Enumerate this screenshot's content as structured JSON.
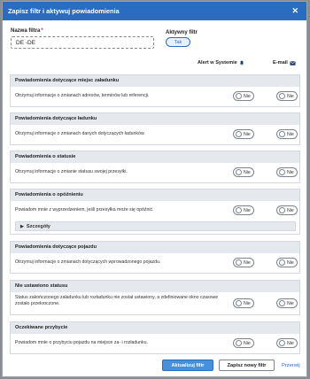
{
  "modal": {
    "title": "Zapisz filtr i aktywuj powiadomienia",
    "close_icon": "close-icon"
  },
  "form": {
    "name_label": "Nazwa filtra",
    "required_mark": "*",
    "name_value": "DE -DE",
    "active_label": "Aktywny filtr",
    "active_toggle": "Tak"
  },
  "columns": {
    "alert": "Alert w Systemie",
    "alert_icon": "bell-icon",
    "email": "E-mail",
    "email_icon": "envelope-icon"
  },
  "toggle_off_label": "Nie",
  "sections": [
    {
      "title": "Powiadomienia dotyczące miejsc załadunku",
      "description": "Otrzymuj informacje o zmianach adresów, terminów lub referencji."
    },
    {
      "title": "Powiadomienia dotyczące ładunku",
      "description": "Otrzymuj informacje o zmianach danych dotyczących ładunków."
    },
    {
      "title": "Powiadomienia o statusie",
      "description": "Otrzymuj informacje o zmianie statusu swojej przesyłki."
    },
    {
      "title": "Powiadomienia o opóźnieniu",
      "description": "Powiadom mnie z wyprzedzeniem, jeśli przesyłka może się opóźnić.",
      "details_label": "Szczegóły"
    },
    {
      "title": "Powiadomienia dotyczące pojazdu",
      "description": "Otrzymuj informacje o zmianach dotyczących wprowadzonego pojazdu."
    },
    {
      "title": "Nie ustawiono statusu",
      "description": "Status zakończonego załadunku lub rozładunku nie został ustawiony, a zdefiniowane okno czasowe zostało przekroczone."
    },
    {
      "title": "Oczekiwane przybycie",
      "description": "Powiadom mnie o przybyciu pojazdu na miejsce za- i rozładunku."
    }
  ],
  "footer": {
    "update_button": "Aktualizuj filtr",
    "save_new_button": "Zapisz nowy filtr",
    "cancel_link": "Przerwij"
  },
  "colors": {
    "header": "#2a6dc0",
    "section_head": "#e5e9ee",
    "primary_button": "#4a90d9",
    "link": "#2a6dc0"
  }
}
